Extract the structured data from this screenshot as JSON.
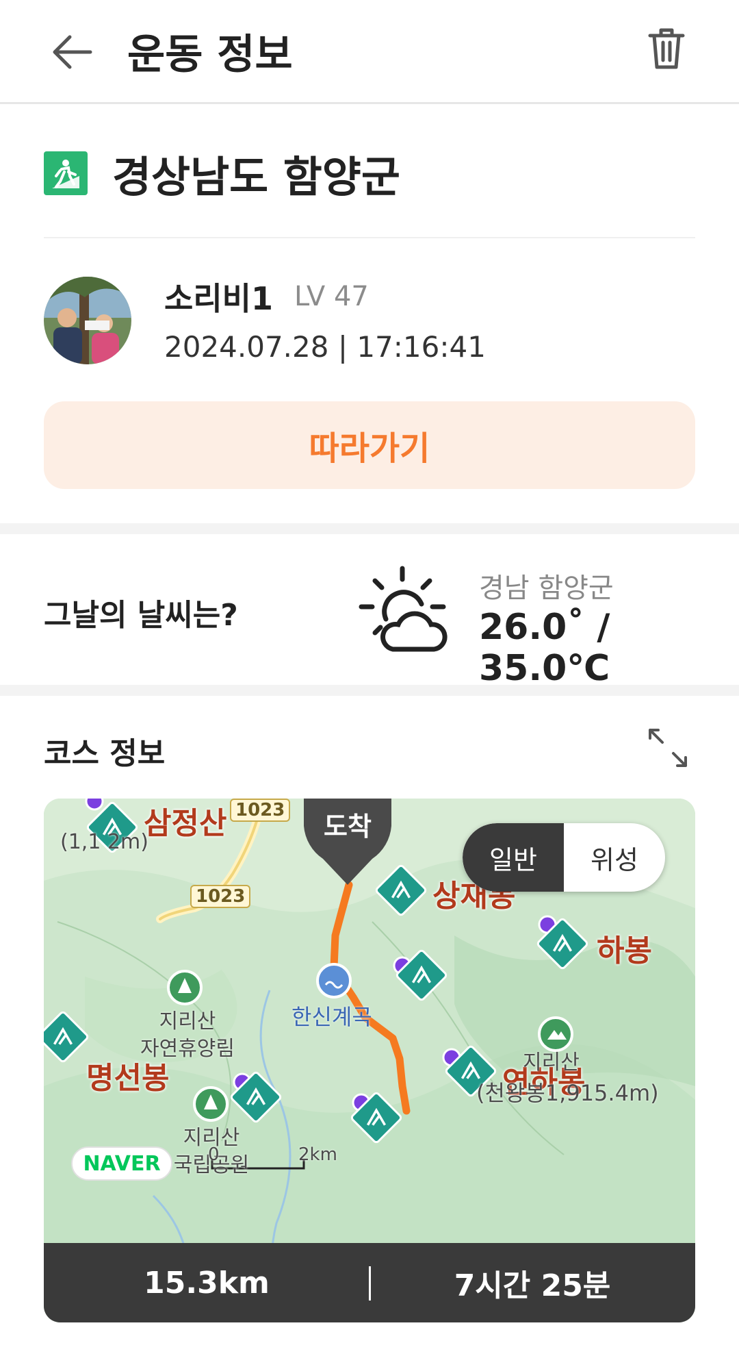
{
  "header": {
    "title": "운동 정보",
    "back_icon": "arrow-left-icon",
    "delete_icon": "trash-icon"
  },
  "activity": {
    "icon": "hiking-icon",
    "title": "경상남도 함양군",
    "accent_color": "#2bb673"
  },
  "user": {
    "name": "소리비1",
    "level": "LV 47",
    "datetime": "2024.07.28 | 17:16:41"
  },
  "follow_button": {
    "label": "따라가기",
    "text_color": "#f57a2e",
    "bg_color": "#fdeee4"
  },
  "weather": {
    "question": "그날의 날씨는?",
    "icon": "partly-cloudy-icon",
    "location": "경남 함양군",
    "temperature": "26.0˚ / 35.0℃"
  },
  "course": {
    "title": "코스 정보",
    "expand_icon": "expand-icon",
    "map": {
      "arrive_label": "도착",
      "toggle": {
        "options": [
          "일반",
          "위성"
        ],
        "selected": "일반"
      },
      "labels": {
        "samjeongsan": "삼정산",
        "samjeongsan_height": "(1,1 2m)",
        "sangjaebong": "상재봉",
        "habong": "하봉",
        "myeongseonbong": "명선봉",
        "yeonhabong": "연하봉",
        "yeonhabong_height": "(천왕봉1,915.4m)",
        "jirisan_park_label": "지리산",
        "jirisan_park_sub": "국립공원",
        "jirisan_forest_label": "지리산",
        "jirisan_forest_sub": "자연휴양림",
        "jirisan_top_label": "지리산",
        "hansin_valley": "한신계곡",
        "road_1": "1023",
        "road_2": "1023",
        "scale_left": "0",
        "scale_right": "2km",
        "naver": "NAVER"
      }
    },
    "stats": {
      "distance": "15.3km",
      "duration": "7시간 25분"
    }
  }
}
